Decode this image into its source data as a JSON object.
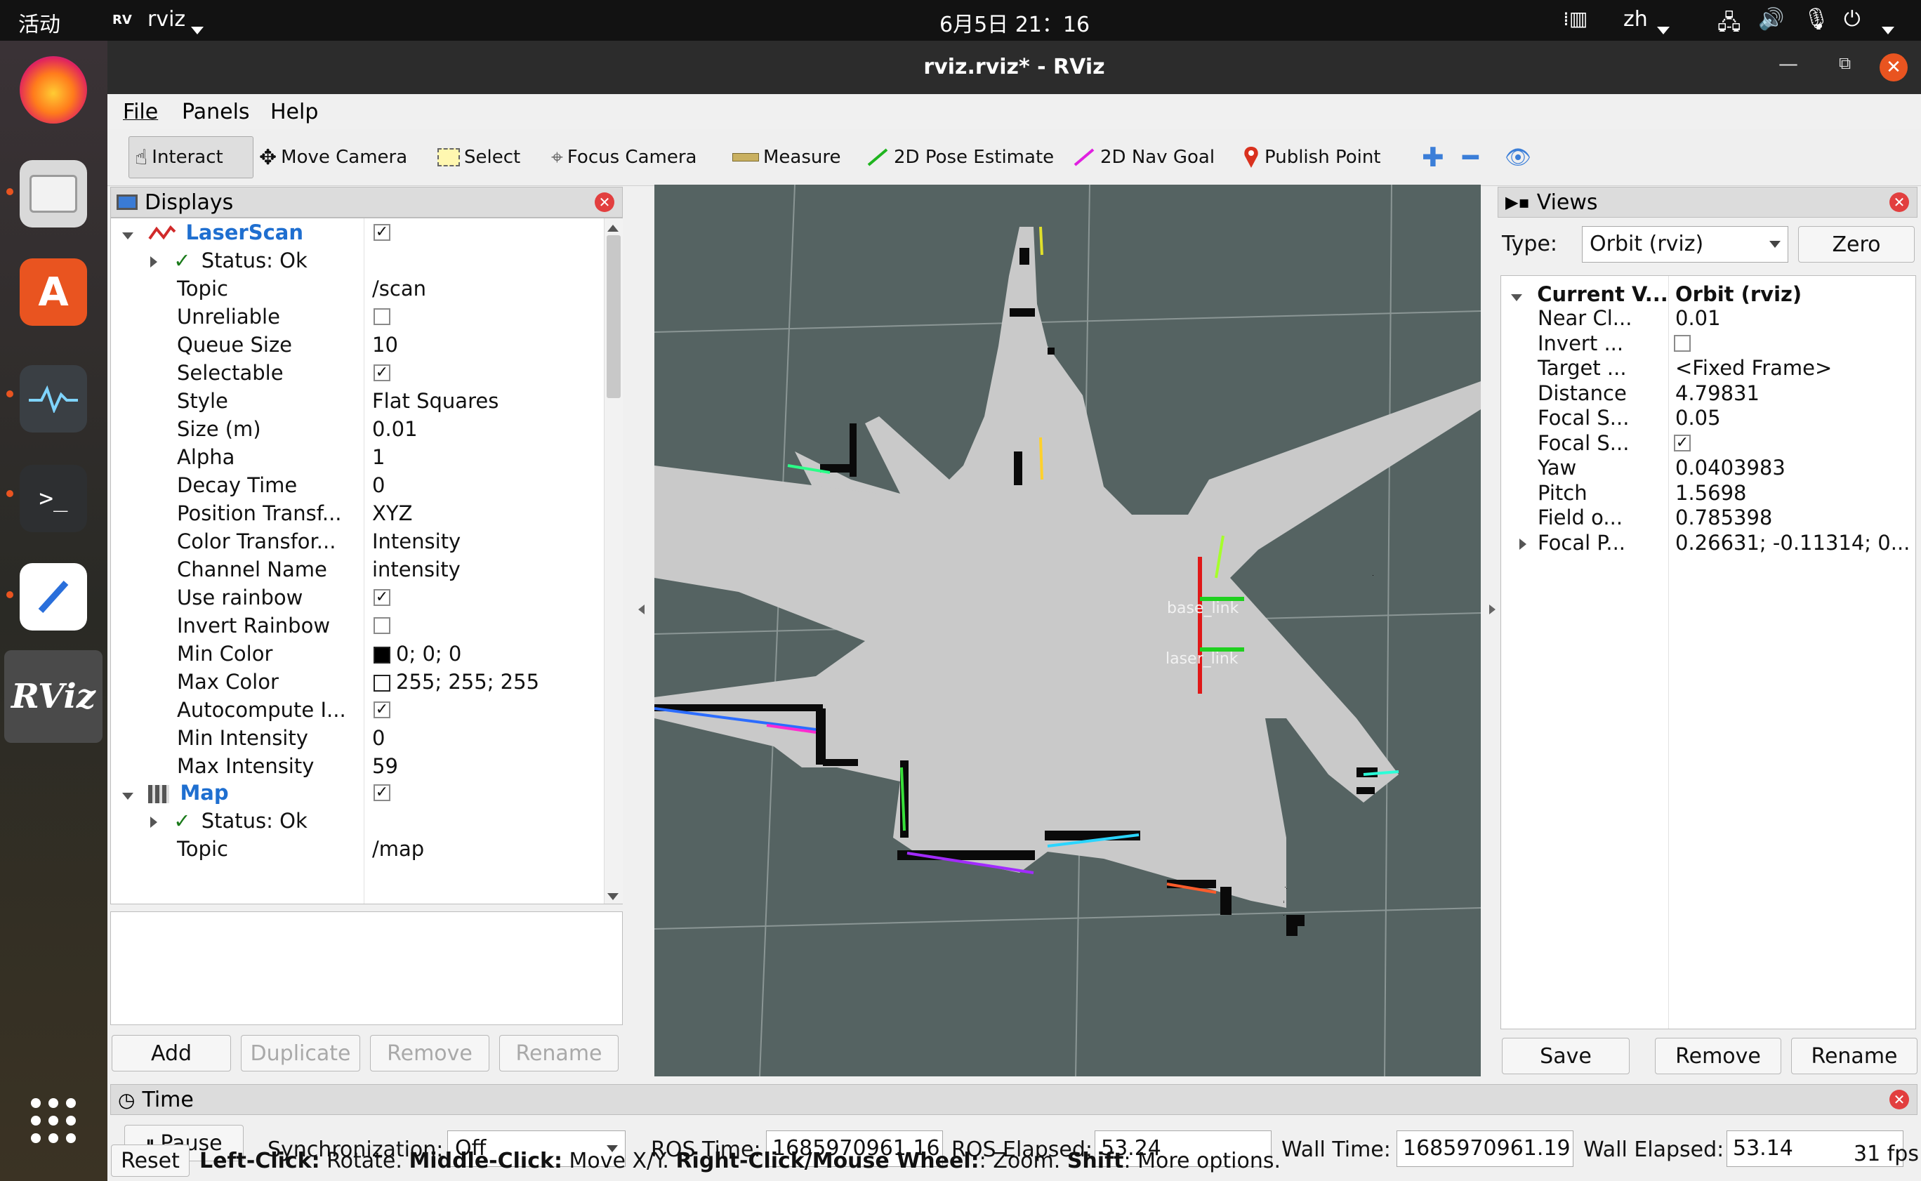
{
  "topbar": {
    "activities": "活动",
    "app_name": "rviz",
    "clock": "6月5日  21：16",
    "lang": "zh"
  },
  "window": {
    "title": "rviz.rviz* - RViz"
  },
  "menu": {
    "file": "File",
    "panels": "Panels",
    "help": "Help"
  },
  "toolbar": {
    "interact": "Interact",
    "move_camera": "Move Camera",
    "select": "Select",
    "focus_camera": "Focus Camera",
    "measure": "Measure",
    "pose_estimate": "2D Pose Estimate",
    "nav_goal": "2D Nav Goal",
    "publish_point": "Publish Point"
  },
  "displays": {
    "title": "Displays",
    "laserscan": {
      "name": "LaserScan",
      "status": "Status: Ok",
      "props": [
        {
          "k": "Topic",
          "v": "/scan"
        },
        {
          "k": "Unreliable",
          "v": ""
        },
        {
          "k": "Queue Size",
          "v": "10"
        },
        {
          "k": "Selectable",
          "v": ""
        },
        {
          "k": "Style",
          "v": "Flat Squares"
        },
        {
          "k": "Size (m)",
          "v": "0.01"
        },
        {
          "k": "Alpha",
          "v": "1"
        },
        {
          "k": "Decay Time",
          "v": "0"
        },
        {
          "k": "Position Transf...",
          "v": "XYZ"
        },
        {
          "k": "Color Transfor...",
          "v": "Intensity"
        },
        {
          "k": "Channel Name",
          "v": "intensity"
        },
        {
          "k": "Use rainbow",
          "v": ""
        },
        {
          "k": "Invert Rainbow",
          "v": ""
        },
        {
          "k": "Min Color",
          "v": "0; 0; 0"
        },
        {
          "k": "Max Color",
          "v": "255; 255; 255"
        },
        {
          "k": "Autocompute I...",
          "v": ""
        },
        {
          "k": "Min Intensity",
          "v": "0"
        },
        {
          "k": "Max Intensity",
          "v": "59"
        }
      ]
    },
    "map": {
      "name": "Map",
      "status": "Status: Ok",
      "topic_k": "Topic",
      "topic_v": "/map"
    },
    "buttons": {
      "add": "Add",
      "duplicate": "Duplicate",
      "remove": "Remove",
      "rename": "Rename"
    }
  },
  "viewport": {
    "frame1": "base_link",
    "frame2": "laser_link"
  },
  "views": {
    "title": "Views",
    "type_label": "Type:",
    "type_value": "Orbit (rviz)",
    "zero": "Zero",
    "current_k": "Current V...",
    "current_v": "Orbit (rviz)",
    "props": [
      {
        "k": "Near Cl...",
        "v": "0.01"
      },
      {
        "k": "Invert ...",
        "v": ""
      },
      {
        "k": "Target ...",
        "v": "<Fixed Frame>"
      },
      {
        "k": "Distance",
        "v": "4.79831"
      },
      {
        "k": "Focal S...",
        "v": "0.05"
      },
      {
        "k": "Focal S...",
        "v": ""
      },
      {
        "k": "Yaw",
        "v": "0.0403983"
      },
      {
        "k": "Pitch",
        "v": "1.5698"
      },
      {
        "k": "Field o...",
        "v": "0.785398"
      },
      {
        "k": "Focal P...",
        "v": "0.26631; -0.11314; 0..."
      }
    ],
    "buttons": {
      "save": "Save",
      "remove": "Remove",
      "rename": "Rename"
    }
  },
  "time": {
    "title": "Time",
    "pause": "Pause",
    "sync_label": "Synchronization:",
    "sync_value": "Off",
    "ros_time_label": "ROS Time:",
    "ros_time": "1685970961.16",
    "ros_elapsed_label": "ROS Elapsed:",
    "ros_elapsed": "53.24",
    "wall_time_label": "Wall Time:",
    "wall_time": "1685970961.19",
    "wall_elapsed_label": "Wall Elapsed:",
    "wall_elapsed": "53.14"
  },
  "status": {
    "reset": "Reset",
    "h1": "Left-Click:",
    "t1": " Rotate. ",
    "h2": "Middle-Click:",
    "t2": " Move X/Y. ",
    "h3": "Right-Click/Mouse Wheel:",
    "t3": ": Zoom. ",
    "h4": "Shift",
    "t4": ": More options.",
    "fps": "31 fps"
  },
  "colors": {
    "accent_blue": "#1f6fd0",
    "close_red": "#e23f3f",
    "ubuntu_orange": "#e95420",
    "viewport_bg": "#556362"
  }
}
